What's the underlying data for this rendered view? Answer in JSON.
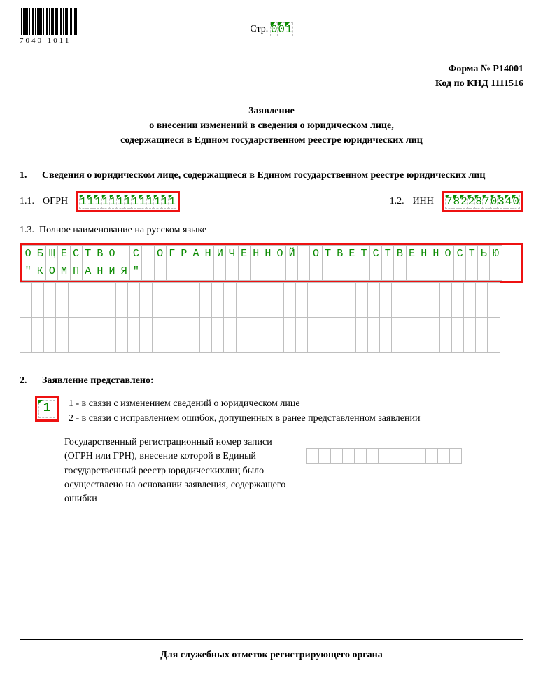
{
  "barcode_number": "7040 1011",
  "page_label": "Стр.",
  "page_number": "001",
  "form_number": "Форма № Р14001",
  "knd_code": "Код по КНД 1111516",
  "title_lines": [
    "Заявление",
    "о внесении изменений в сведения о юридическом лице,",
    "содержащиеся в Едином государственном реестре юридических лиц"
  ],
  "section1": {
    "number": "1.",
    "heading": "Сведения о юридическом лице, содержащиеся в Едином государственном реестре юридических лиц",
    "ogrn_num": "1.1.",
    "ogrn_label": "ОГРН",
    "ogrn_value": "1111111111111",
    "inn_num": "1.2.",
    "inn_label": "ИНН",
    "inn_value": "7822870340",
    "name_num": "1.3.",
    "name_label": "Полное наименование на русском языке",
    "name_lines": [
      "ОБЩЕСТВО С ОГРАНИЧЕННОЙ ОТВЕТСТВЕННОСТЬЮ",
      "\"КОМПАНИЯ\"",
      "",
      "",
      "",
      ""
    ]
  },
  "section2": {
    "number": "2.",
    "heading": "Заявление представлено:",
    "reason_value": "1",
    "reason_options": [
      "1 - в связи с изменением сведений о юридическом лице",
      "2 - в связи с исправлением ошибок, допущенных в ранее представленном заявлении"
    ],
    "grn_text": "Государственный регистрационный номер записи (ОГРН или ГРН), внесение которой в Единый государственный реестр юридическихлиц было осуществлено на основании заявления, содержащего ошибки",
    "grn_value": "",
    "grn_len": 13
  },
  "footer": "Для служебных отметок регистрирующего органа"
}
